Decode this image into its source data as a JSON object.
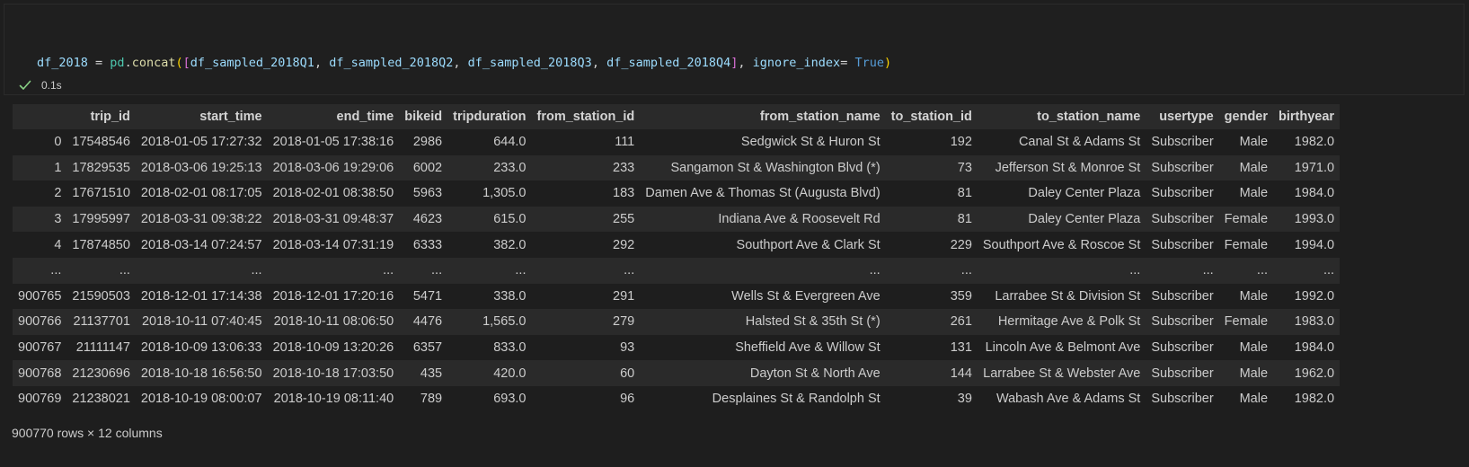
{
  "code_cell": {
    "tokens": {
      "df_2018": "df_2018",
      "eq": " = ",
      "pd": "pd",
      "dot": ".",
      "concat": "concat",
      "paren_open": "(",
      "bracket_open": "[",
      "q1": "df_sampled_2018Q1",
      "q2": "df_sampled_2018Q2",
      "q3": "df_sampled_2018Q3",
      "q4": "df_sampled_2018Q4",
      "comma": ", ",
      "bracket_close": "]",
      "ignore_index": "ignore_index",
      "eq2": "= ",
      "true": "True",
      "paren_close": ")"
    },
    "line2": "df_2018",
    "exec_time": "0.1s"
  },
  "colors": {
    "success_check": "#89d185",
    "background": "#1e1e1e",
    "row_alt": "#2a2a2a"
  },
  "dataframe": {
    "columns": [
      "",
      "trip_id",
      "start_time",
      "end_time",
      "bikeid",
      "tripduration",
      "from_station_id",
      "from_station_name",
      "to_station_id",
      "to_station_name",
      "usertype",
      "gender",
      "birthyear"
    ],
    "rows": [
      [
        "0",
        "17548546",
        "2018-01-05 17:27:32",
        "2018-01-05 17:38:16",
        "2986",
        "644.0",
        "111",
        "Sedgwick St & Huron St",
        "192",
        "Canal St & Adams St",
        "Subscriber",
        "Male",
        "1982.0"
      ],
      [
        "1",
        "17829535",
        "2018-03-06 19:25:13",
        "2018-03-06 19:29:06",
        "6002",
        "233.0",
        "233",
        "Sangamon St & Washington Blvd (*)",
        "73",
        "Jefferson St & Monroe St",
        "Subscriber",
        "Male",
        "1971.0"
      ],
      [
        "2",
        "17671510",
        "2018-02-01 08:17:05",
        "2018-02-01 08:38:50",
        "5963",
        "1,305.0",
        "183",
        "Damen Ave & Thomas St (Augusta Blvd)",
        "81",
        "Daley Center Plaza",
        "Subscriber",
        "Male",
        "1984.0"
      ],
      [
        "3",
        "17995997",
        "2018-03-31 09:38:22",
        "2018-03-31 09:48:37",
        "4623",
        "615.0",
        "255",
        "Indiana Ave & Roosevelt Rd",
        "81",
        "Daley Center Plaza",
        "Subscriber",
        "Female",
        "1993.0"
      ],
      [
        "4",
        "17874850",
        "2018-03-14 07:24:57",
        "2018-03-14 07:31:19",
        "6333",
        "382.0",
        "292",
        "Southport Ave & Clark St",
        "229",
        "Southport Ave & Roscoe St",
        "Subscriber",
        "Female",
        "1994.0"
      ],
      [
        "...",
        "...",
        "...",
        "...",
        "...",
        "...",
        "...",
        "...",
        "...",
        "...",
        "...",
        "...",
        "..."
      ],
      [
        "900765",
        "21590503",
        "2018-12-01 17:14:38",
        "2018-12-01 17:20:16",
        "5471",
        "338.0",
        "291",
        "Wells St & Evergreen Ave",
        "359",
        "Larrabee St & Division St",
        "Subscriber",
        "Male",
        "1992.0"
      ],
      [
        "900766",
        "21137701",
        "2018-10-11 07:40:45",
        "2018-10-11 08:06:50",
        "4476",
        "1,565.0",
        "279",
        "Halsted St & 35th St (*)",
        "261",
        "Hermitage Ave & Polk St",
        "Subscriber",
        "Female",
        "1983.0"
      ],
      [
        "900767",
        "21111147",
        "2018-10-09 13:06:33",
        "2018-10-09 13:20:26",
        "6357",
        "833.0",
        "93",
        "Sheffield Ave & Willow St",
        "131",
        "Lincoln Ave & Belmont Ave",
        "Subscriber",
        "Male",
        "1984.0"
      ],
      [
        "900768",
        "21230696",
        "2018-10-18 16:56:50",
        "2018-10-18 17:03:50",
        "435",
        "420.0",
        "60",
        "Dayton St & North Ave",
        "144",
        "Larrabee St & Webster Ave",
        "Subscriber",
        "Male",
        "1962.0"
      ],
      [
        "900769",
        "21238021",
        "2018-10-19 08:00:07",
        "2018-10-19 08:11:40",
        "789",
        "693.0",
        "96",
        "Desplaines St & Randolph St",
        "39",
        "Wabash Ave & Adams St",
        "Subscriber",
        "Male",
        "1982.0"
      ]
    ],
    "shape_text": "900770 rows × 12 columns"
  }
}
